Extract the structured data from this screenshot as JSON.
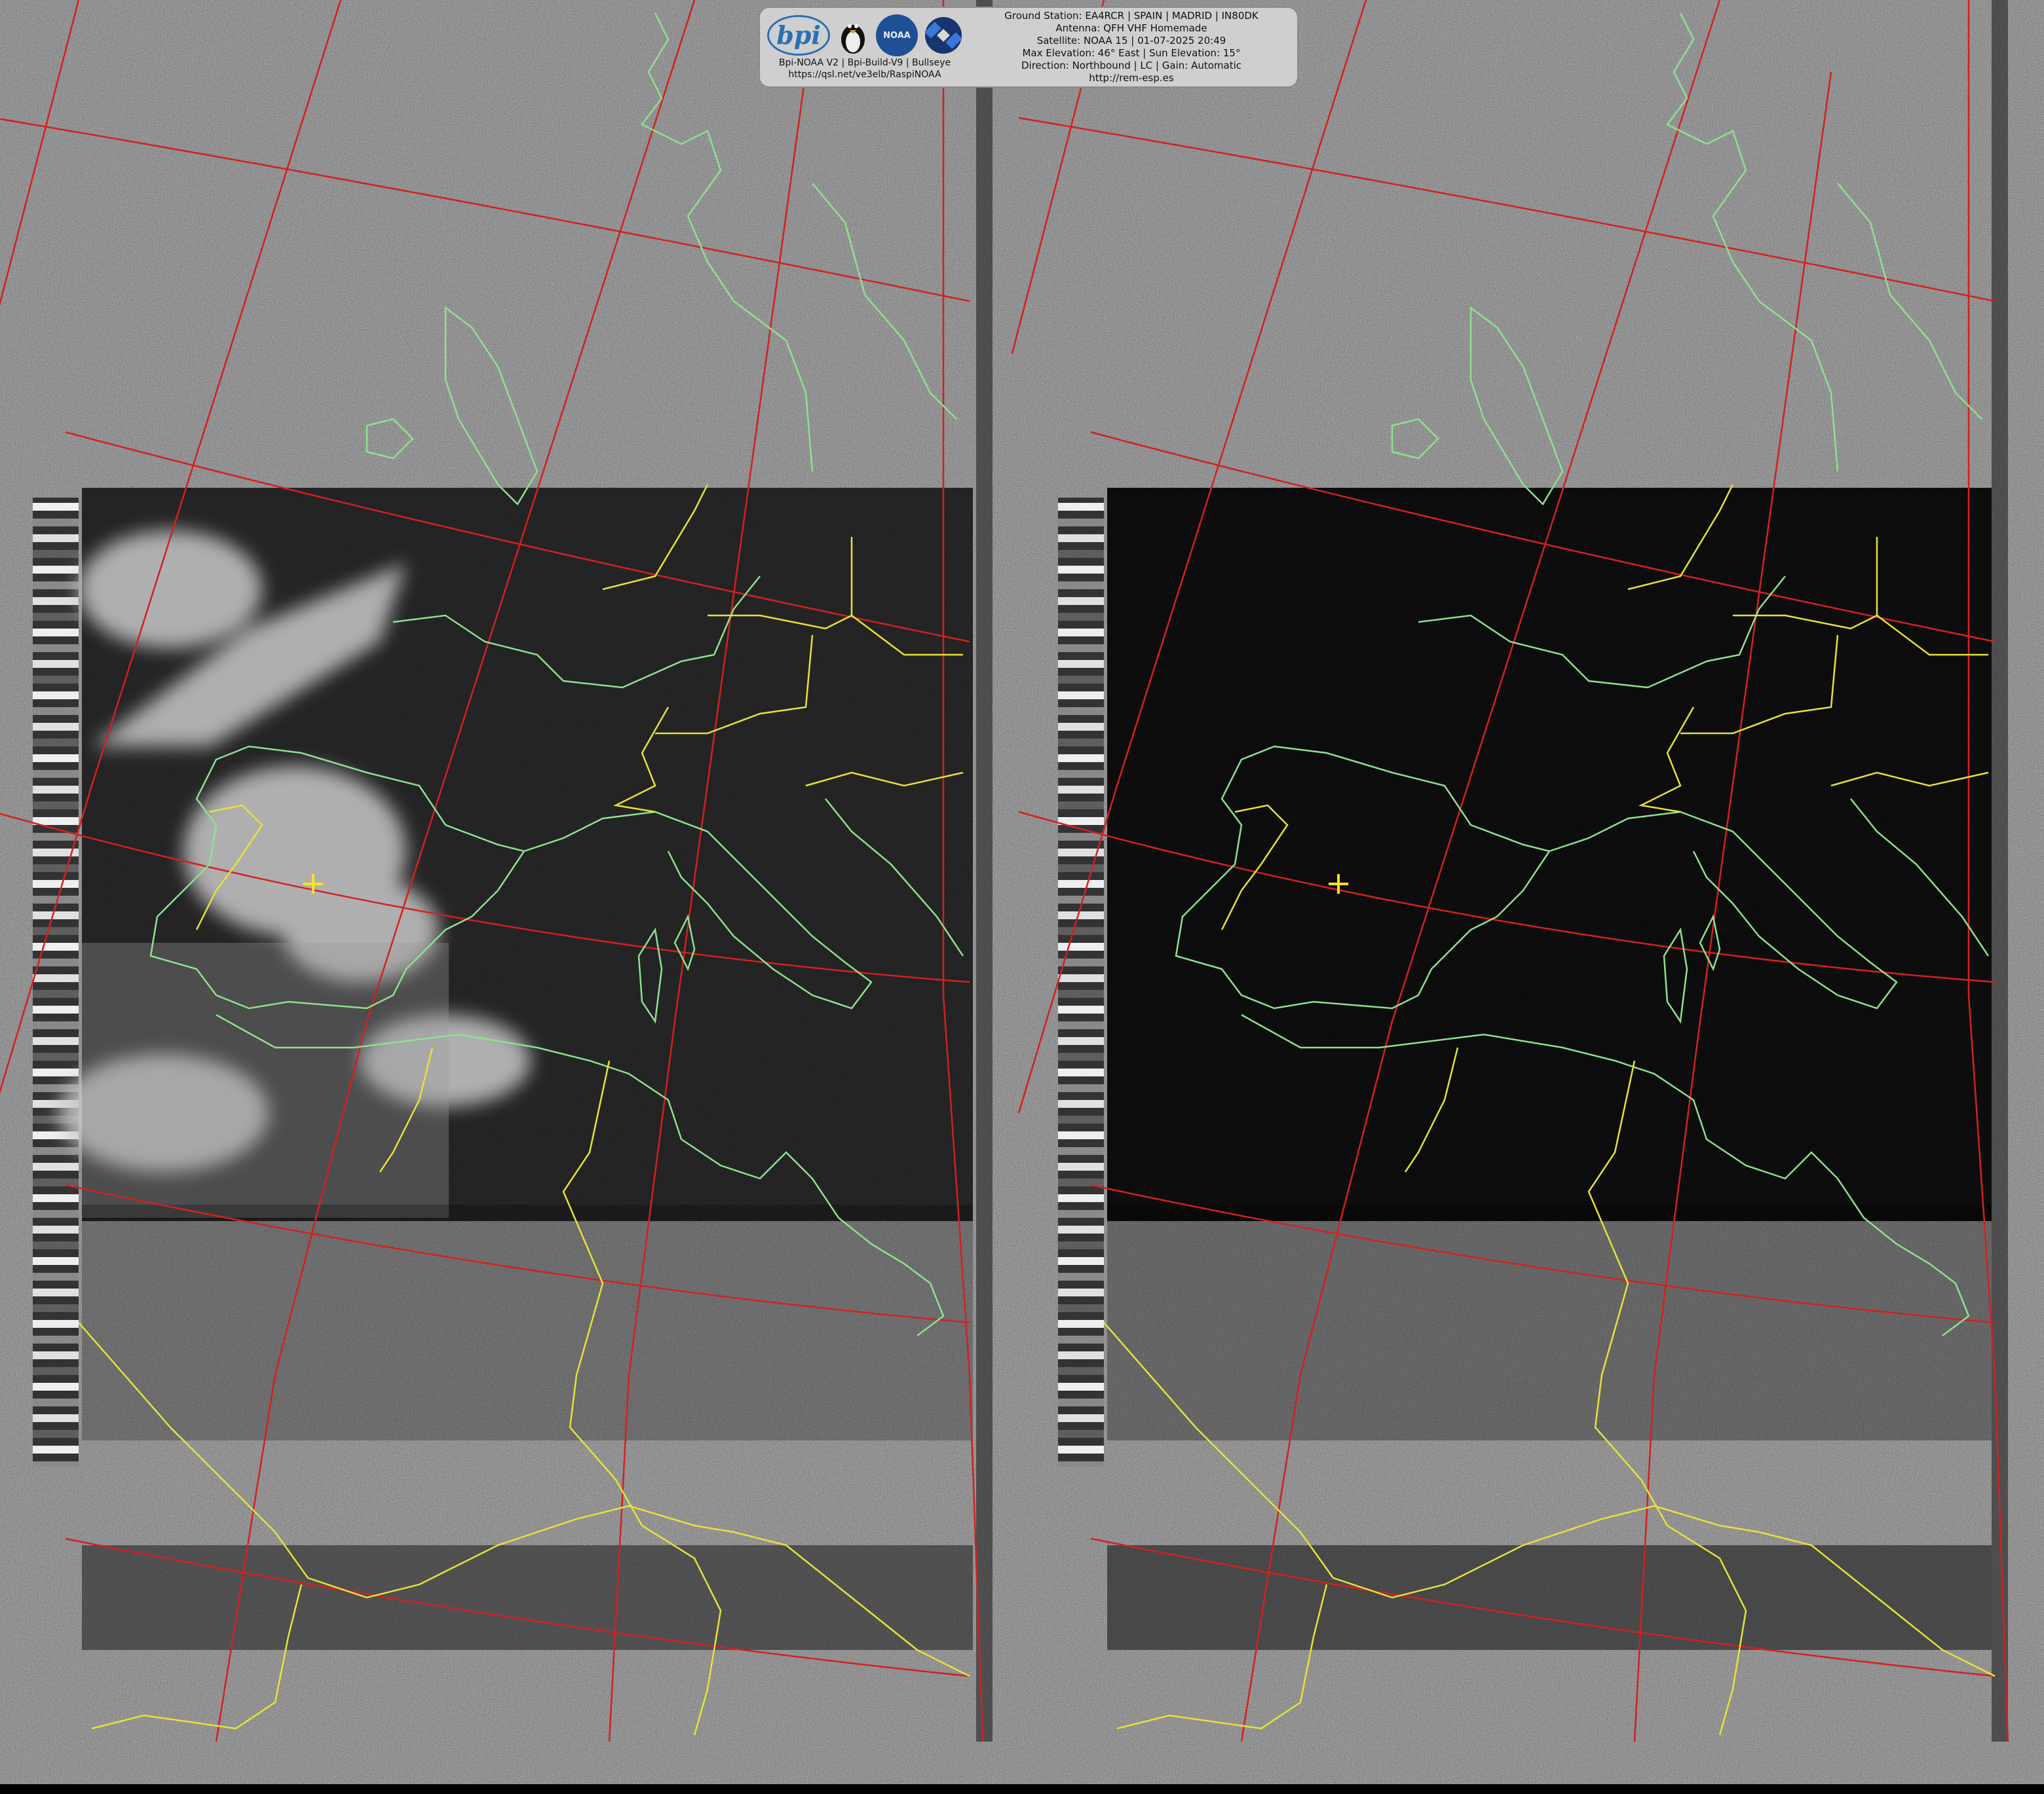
{
  "banner": {
    "brand_line1": "Bpi-NOAA V2 | Bpi-Build-V9 | Bullseye",
    "brand_line2": "https://qsl.net/ve3elb/RaspiNOAA",
    "bpi_logo_text": "bpi",
    "noaa_logo_text": "NOAA",
    "lines": [
      "Ground Station: EA4RCR | SPAIN | MADRID | IN80DK",
      "Antenna: QFH VHF Homemade",
      "Satellite: NOAA 15 | 01-07-2025 20:49",
      "Max Elevation: 46° East | Sun Elevation: 15°",
      "Direction: Northbound | LC | Gain: Automatic",
      "http://rem-esp.es"
    ]
  },
  "colors": {
    "coastline": "#8fe08f",
    "border": "#e6e23a",
    "graticule": "#d42020",
    "marker": "#ffe41a"
  },
  "icons": [
    "bpi-logo",
    "tux-icon",
    "noaa-logo",
    "satellite-icon",
    "station-marker-icon"
  ]
}
